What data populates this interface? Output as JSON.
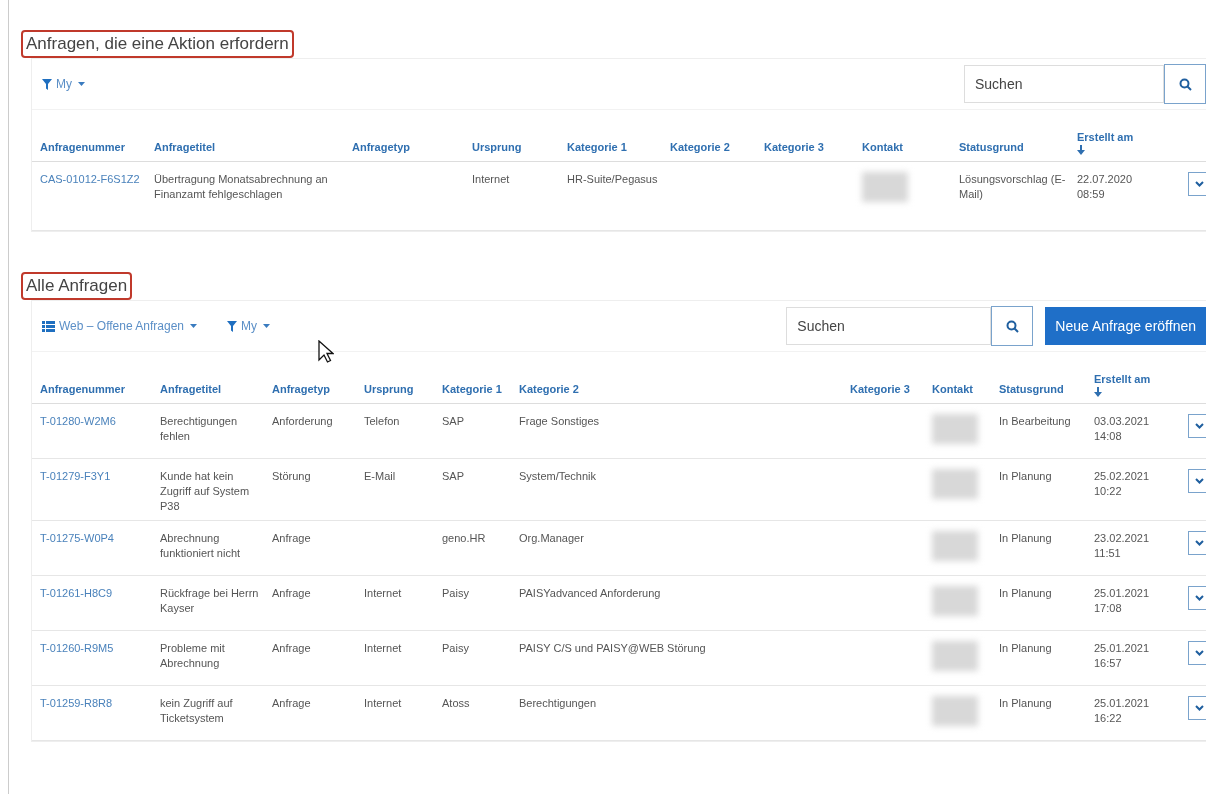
{
  "sections": [
    {
      "heading": "Anfragen, die eine Aktion erfordern",
      "kind": "action",
      "filter": "My",
      "search": {
        "placeholder": "Suchen"
      },
      "columns": [
        "Anfragenummer",
        "Anfragetitel",
        "Anfragetyp",
        "Ursprung",
        "Kategorie 1",
        "Kategorie 2",
        "Kategorie 3",
        "Kontakt",
        "Statusgrund",
        "Erstellt am"
      ],
      "rows": [
        {
          "number": "CAS-01012-F6S1Z2",
          "title": "Übertragung Monatsabrechnung an Finanzamt fehlgeschlagen",
          "origin": "Internet",
          "cat1": "HR-Suite/Pegasus",
          "status": "Lösungsvorschlag (E-Mail)",
          "date": "22.07.2020",
          "time": "08:59"
        }
      ]
    },
    {
      "heading": "Alle Anfragen",
      "kind": "all",
      "view": "Web – Offene Anfragen",
      "filter": "My",
      "search": {
        "placeholder": "Suchen"
      },
      "new_button": "Neue Anfrage eröffnen",
      "columns": [
        "Anfragenummer",
        "Anfragetitel",
        "Anfragetyp",
        "Ursprung",
        "Kategorie 1",
        "Kategorie 2",
        "Kategorie 3",
        "Kontakt",
        "Statusgrund",
        "Erstellt am"
      ],
      "rows": [
        {
          "number": "T-01280-W2M6",
          "title": "Berechtigungen fehlen",
          "type": "Anforderung",
          "origin": "Telefon",
          "cat1": "SAP",
          "cat2": "Frage Sonstiges",
          "status": "In Bearbeitung",
          "date": "03.03.2021",
          "time": "14:08"
        },
        {
          "number": "T-01279-F3Y1",
          "title": "Kunde hat kein Zugriff auf System P38",
          "type": "Störung",
          "origin": "E-Mail",
          "cat1": "SAP",
          "cat2": "System/Technik",
          "status": "In Planung",
          "date": "25.02.2021",
          "time": "10:22"
        },
        {
          "number": "T-01275-W0P4",
          "title": "Abrechnung funktioniert nicht",
          "type": "Anfrage",
          "cat1": "geno.HR",
          "cat2": "Org.Manager",
          "status": "In Planung",
          "date": "23.02.2021",
          "time": "11:51"
        },
        {
          "number": "T-01261-H8C9",
          "title": "Rückfrage bei Herrn Kayser",
          "type": "Anfrage",
          "origin": "Internet",
          "cat1": "Paisy",
          "cat2": "PAISYadvanced Anforderung",
          "status": "In Planung",
          "date": "25.01.2021",
          "time": "17:08"
        },
        {
          "number": "T-01260-R9M5",
          "title": "Probleme mit Abrechnung",
          "type": "Anfrage",
          "origin": "Internet",
          "cat1": "Paisy",
          "cat2": "PAISY C/S und PAISY@WEB Störung",
          "status": "In Planung",
          "date": "25.01.2021",
          "time": "16:57"
        },
        {
          "number": "T-01259-R8R8",
          "title": "kein Zugriff auf Ticketsystem",
          "type": "Anfrage",
          "origin": "Internet",
          "cat1": "Atoss",
          "cat2": "Berechtigungen",
          "status": "In Planung",
          "date": "25.01.2021",
          "time": "16:22"
        }
      ]
    }
  ]
}
